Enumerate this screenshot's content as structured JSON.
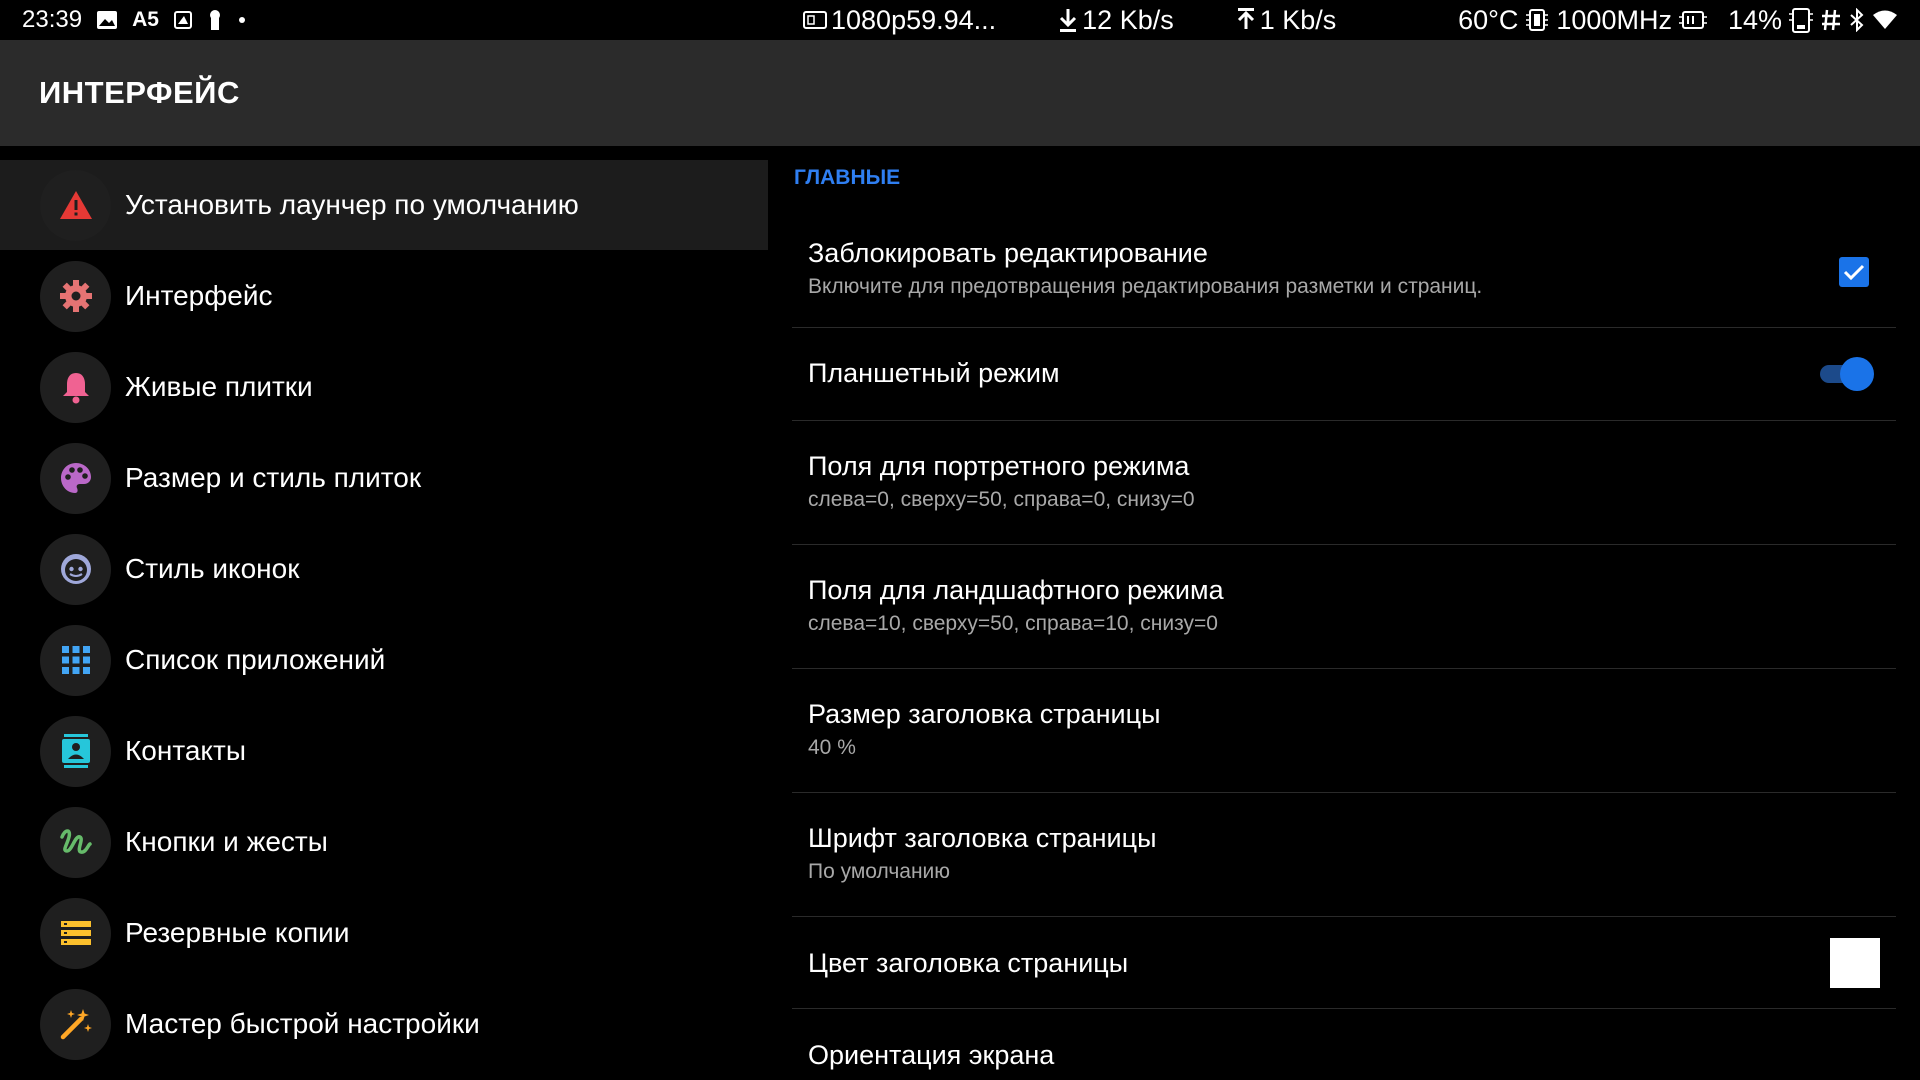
{
  "status_bar": {
    "time": "23:39",
    "left_icons": [
      "image-icon",
      "a5-icon",
      "screenshot-icon",
      "keyhole-icon",
      "dot-icon"
    ],
    "left_a5": "A5",
    "resolution": "1080p59.94...",
    "download": "12 Kb/s",
    "upload": "1 Kb/s",
    "temperature": "60°C",
    "cpu_freq": "1000MHz",
    "battery": "14%"
  },
  "app_bar": {
    "title": "ИНТЕРФЕЙС"
  },
  "nav": {
    "items": [
      {
        "label": "Установить лаунчер по умолчанию",
        "icon": "warning-icon",
        "color": "#e53935",
        "selected": true
      },
      {
        "label": "Интерфейс",
        "icon": "gear-icon",
        "color": "#e57373",
        "selected": false
      },
      {
        "label": "Живые плитки",
        "icon": "bell-icon",
        "color": "#f06292",
        "selected": false
      },
      {
        "label": "Размер и стиль плиток",
        "icon": "palette-icon",
        "color": "#ba68c8",
        "selected": false
      },
      {
        "label": "Стиль иконок",
        "icon": "face-icon",
        "color": "#9fa8da",
        "selected": false
      },
      {
        "label": "Список приложений",
        "icon": "grid-icon",
        "color": "#42a5f5",
        "selected": false
      },
      {
        "label": "Контакты",
        "icon": "contact-card-icon",
        "color": "#26c6da",
        "selected": false
      },
      {
        "label": "Кнопки и жесты",
        "icon": "gesture-icon",
        "color": "#66bb6a",
        "selected": false
      },
      {
        "label": "Резервные копии",
        "icon": "storage-icon",
        "color": "#fbc02d",
        "selected": false
      },
      {
        "label": "Мастер быстрой настройки",
        "icon": "magic-wand-icon",
        "color": "#ffa726",
        "selected": false
      }
    ]
  },
  "prefs": {
    "section_header": "ГЛАВНЫЕ",
    "items": [
      {
        "title": "Заблокировать редактирование",
        "summary": "Включите для предотвращения редактирования разметки и страниц.",
        "widget": "checkbox",
        "checked": true
      },
      {
        "title": "Планшетный режим",
        "summary": "",
        "widget": "switch",
        "checked": true
      },
      {
        "title": "Поля для портретного режима",
        "summary": "слева=0, сверху=50, справа=0, снизу=0",
        "widget": "none"
      },
      {
        "title": "Поля для ландшафтного режима",
        "summary": "слева=10, сверху=50, справа=10, снизу=0",
        "widget": "none"
      },
      {
        "title": "Размер заголовка страницы",
        "summary": "40 %",
        "widget": "none"
      },
      {
        "title": "Шрифт заголовка страницы",
        "summary": "По умолчанию",
        "widget": "none"
      },
      {
        "title": "Цвет заголовка страницы",
        "summary": "",
        "widget": "color",
        "color": "#ffffff"
      },
      {
        "title": "Ориентация экрана",
        "summary": "",
        "widget": "none"
      }
    ]
  },
  "colors": {
    "accent": "#2f7ff2",
    "app_bar_bg": "#2b2b2b",
    "background": "#000000"
  }
}
